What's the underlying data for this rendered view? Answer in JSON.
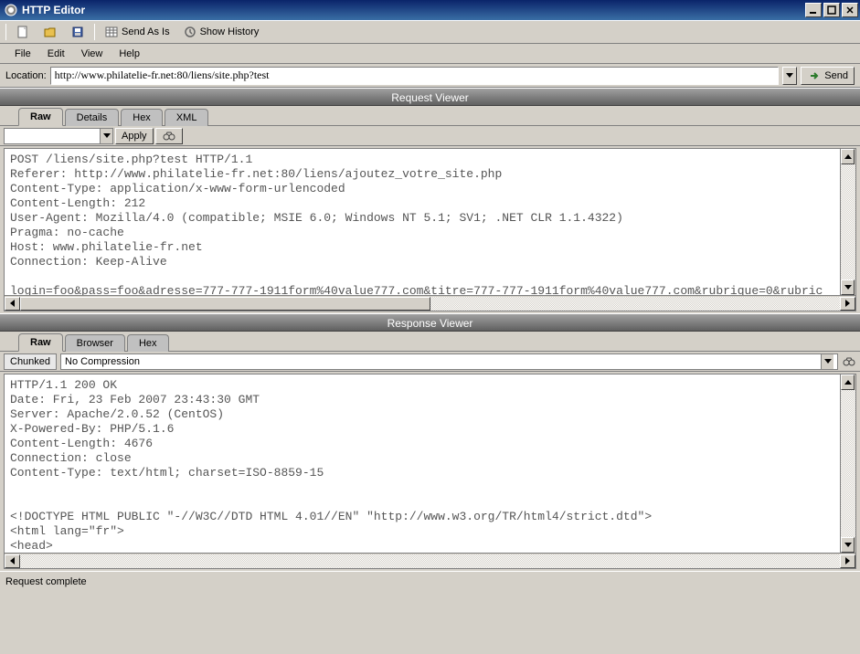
{
  "window": {
    "title": "HTTP Editor"
  },
  "toolbar": {
    "send_as_is": "Send As Is",
    "show_history": "Show History"
  },
  "menu": {
    "file": "File",
    "edit": "Edit",
    "view": "View",
    "help": "Help"
  },
  "location": {
    "label": "Location:",
    "value": "http://www.philatelie-fr.net:80/liens/site.php?test",
    "send": "Send"
  },
  "request": {
    "header": "Request Viewer",
    "tabs": {
      "raw": "Raw",
      "details": "Details",
      "hex": "Hex",
      "xml": "XML"
    },
    "apply": "Apply",
    "content": "POST /liens/site.php?test HTTP/1.1\nReferer: http://www.philatelie-fr.net:80/liens/ajoutez_votre_site.php\nContent-Type: application/x-www-form-urlencoded\nContent-Length: 212\nUser-Agent: Mozilla/4.0 (compatible; MSIE 6.0; Windows NT 5.1; SV1; .NET CLR 1.1.4322)\nPragma: no-cache\nHost: www.philatelie-fr.net\nConnection: Keep-Alive\n\nlogin=foo&pass=foo&adresse=777-777-1911form%40value777.com&titre=777-777-1911form%40value777.com&rubrique=0&rubric"
  },
  "response": {
    "header": "Response Viewer",
    "tabs": {
      "raw": "Raw",
      "browser": "Browser",
      "hex": "Hex"
    },
    "chunked": "Chunked",
    "compression": "No Compression",
    "content": "HTTP/1.1 200 OK\nDate: Fri, 23 Feb 2007 23:43:30 GMT\nServer: Apache/2.0.52 (CentOS)\nX-Powered-By: PHP/5.1.6\nContent-Length: 4676\nConnection: close\nContent-Type: text/html; charset=ISO-8859-15\n\n\n<!DOCTYPE HTML PUBLIC \"-//W3C//DTD HTML 4.01//EN\" \"http://www.w3.org/TR/html4/strict.dtd\">\n<html lang=\"fr\">\n<head>"
  },
  "status": {
    "text": "Request complete"
  }
}
